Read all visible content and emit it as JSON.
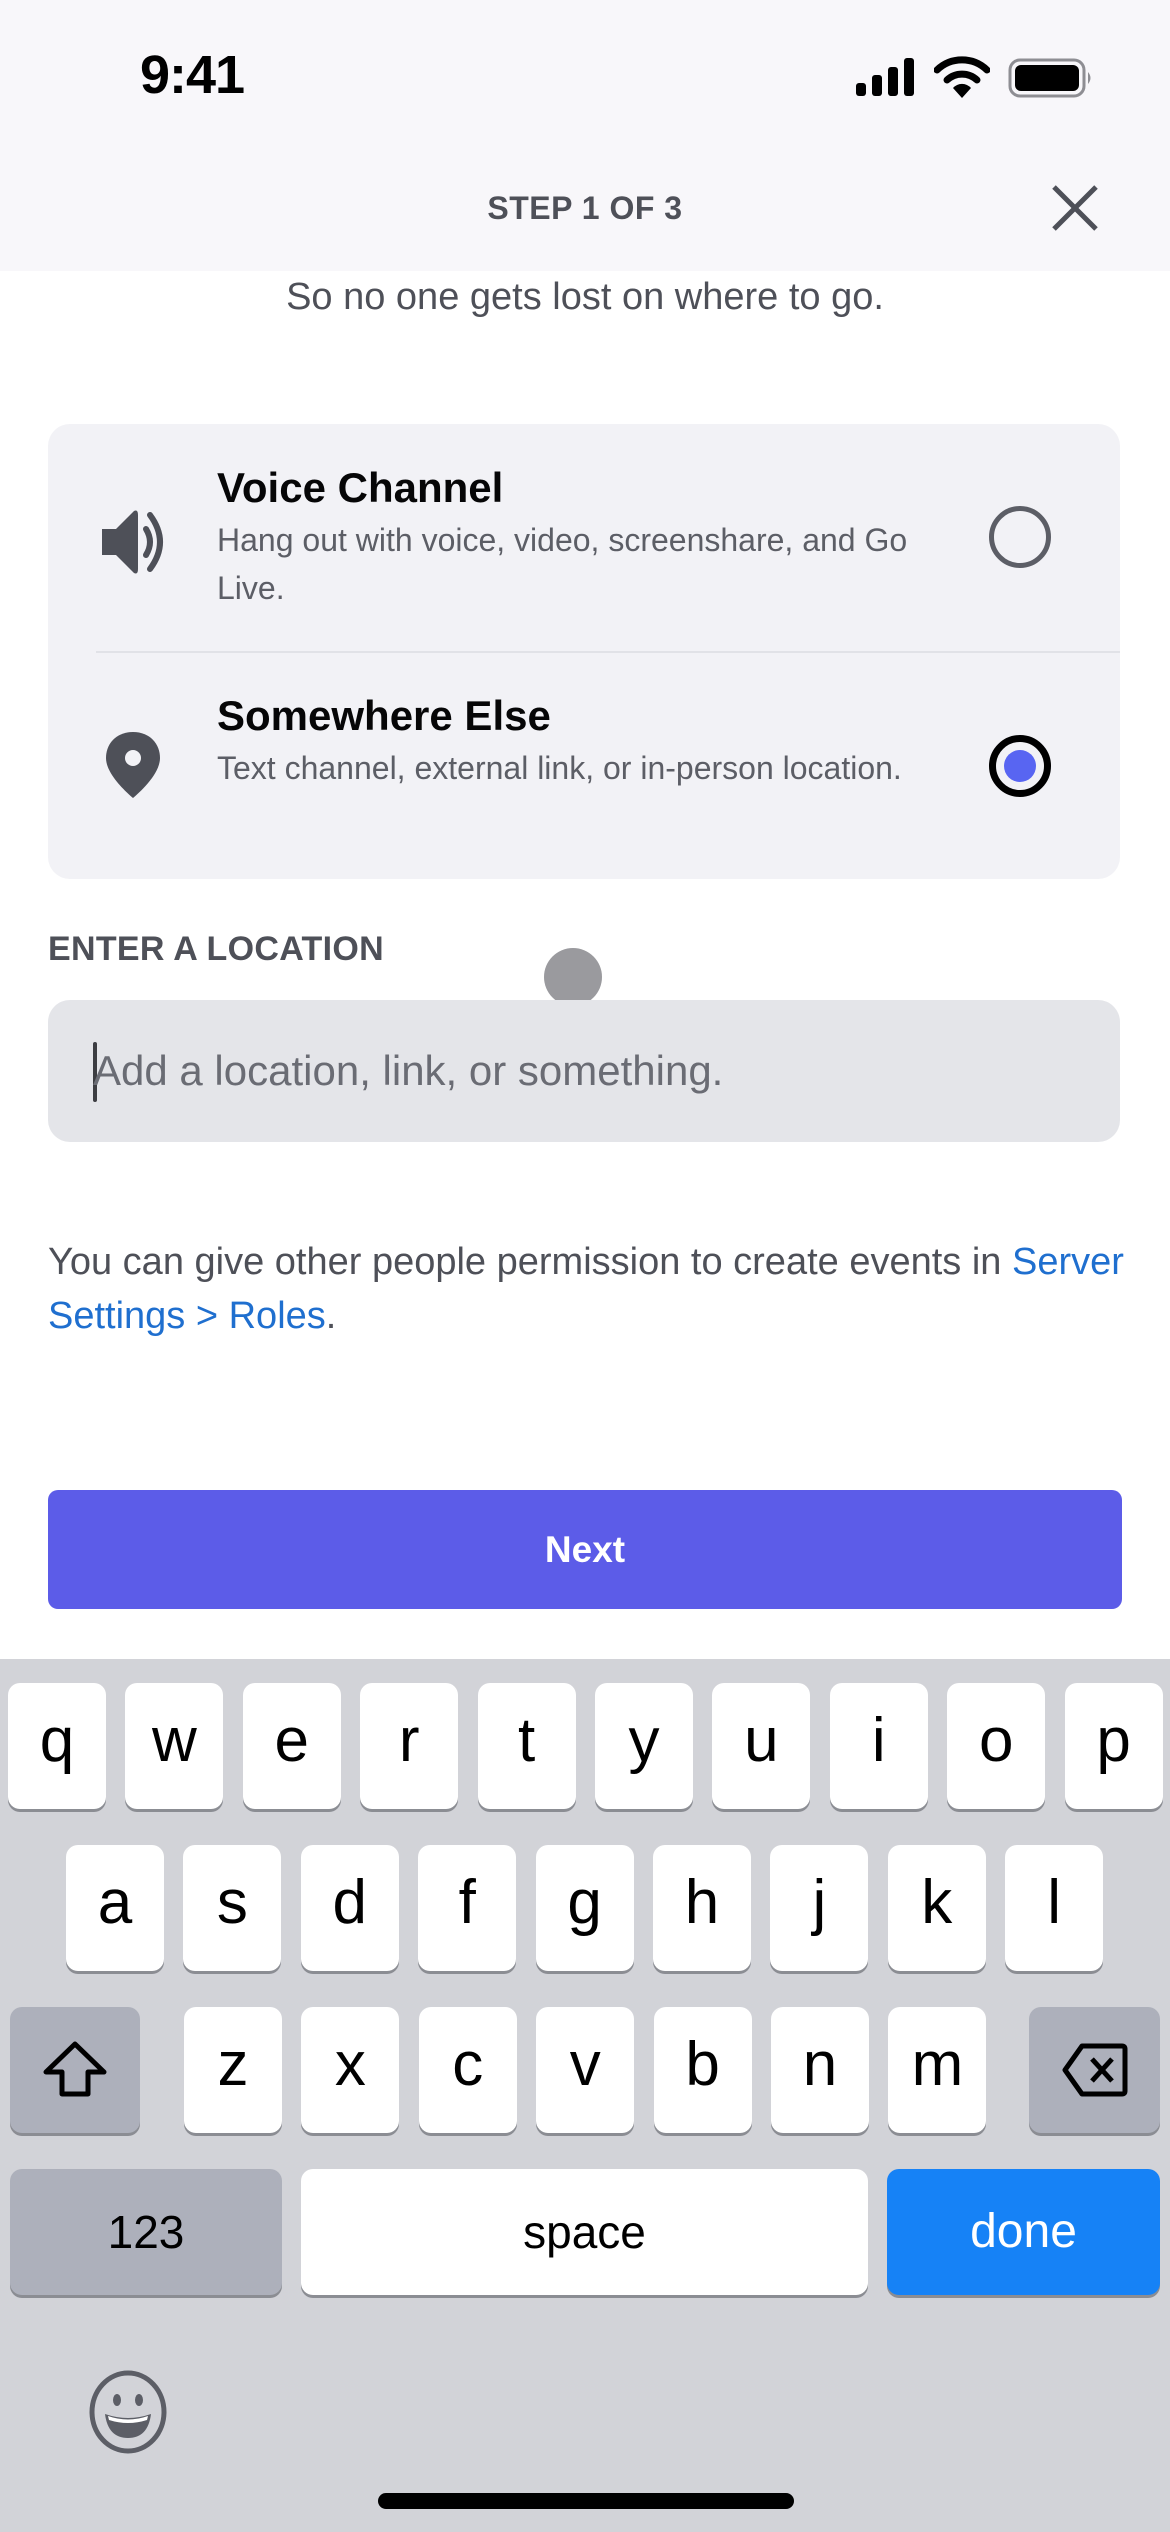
{
  "status_bar": {
    "time": "9:41",
    "icons": [
      "signal-icon",
      "wifi-icon",
      "battery-icon"
    ]
  },
  "header": {
    "title": "STEP 1 OF 3",
    "close_icon": "close-icon"
  },
  "subtitle": "So no one gets lost on where to go.",
  "location_options": [
    {
      "icon": "speaker-icon",
      "title": "Voice Channel",
      "description": "Hang out with voice, video, screenshare, and Go Live.",
      "selected": false
    },
    {
      "icon": "location-pin-icon",
      "title": "Somewhere Else",
      "description": "Text channel, external link, or in-person location.",
      "selected": true
    }
  ],
  "location_field": {
    "label": "ENTER A LOCATION",
    "value": "",
    "placeholder": "Add a location, link, or something."
  },
  "permission_note": {
    "text": "You can give other people permission to create events in ",
    "link": "Server Settings > Roles",
    "suffix": "."
  },
  "next_button": {
    "label": "Next"
  },
  "colors": {
    "accent": "#5865F2",
    "button": "#5C5CE8",
    "link": "#1F6FCF",
    "keyboard_done": "#1682F6"
  },
  "keyboard": {
    "row1": [
      "q",
      "w",
      "e",
      "r",
      "t",
      "y",
      "u",
      "i",
      "o",
      "p"
    ],
    "row2": [
      "a",
      "s",
      "d",
      "f",
      "g",
      "h",
      "j",
      "k",
      "l"
    ],
    "row3": [
      "z",
      "x",
      "c",
      "v",
      "b",
      "n",
      "m"
    ],
    "shift_icon": "shift-icon",
    "delete_icon": "delete-icon",
    "numbers_label": "123",
    "space_label": "space",
    "done_label": "done",
    "emoji_icon": "emoji-icon"
  }
}
